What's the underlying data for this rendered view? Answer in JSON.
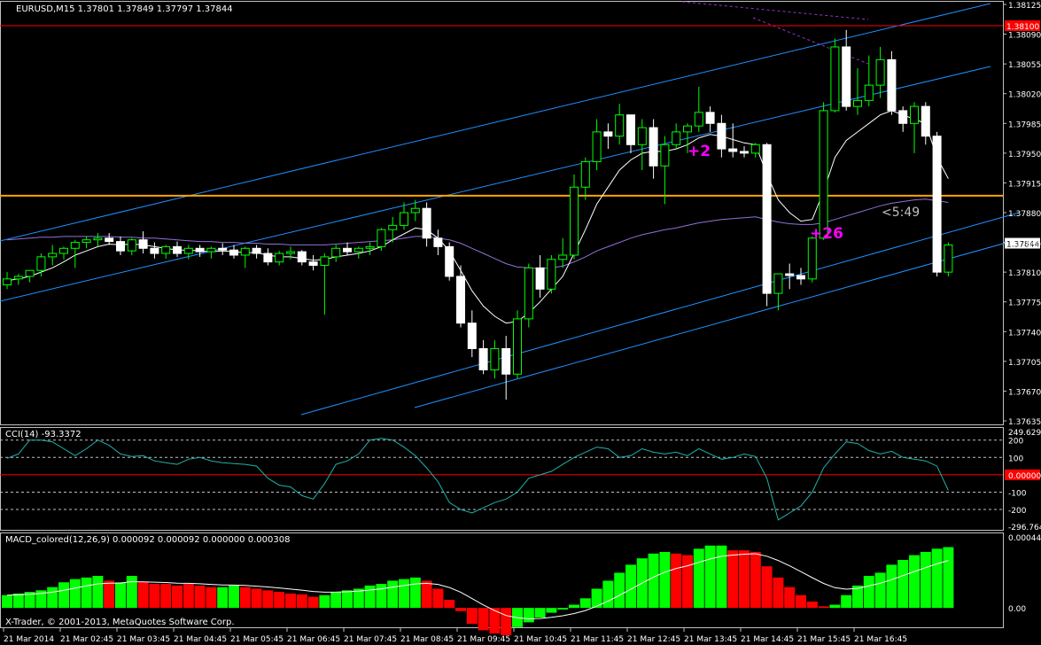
{
  "symbol_header": "EURUSD,M15  1.37801 1.37849 1.37797 1.37844",
  "copyright": "X-Trader, © 2001-2013, MetaQuotes Software Corp.",
  "colors": {
    "background": "#000000",
    "frame": "#c0c0c0",
    "bull": "#00ff00",
    "bear": "#ffffff",
    "channel": "#1e90ff",
    "ma_fast": "#ffffff",
    "ma_slow": "#9370db",
    "level_orange": "#ffa500",
    "level_red": "#ff0000",
    "cci": "#20b2aa",
    "macd_up": "#00ff00",
    "macd_down": "#ff0000",
    "annotation": "#ff00ff",
    "grid": "#c0c0c0"
  },
  "price_panel": {
    "y_ticks": [
      "1.38125",
      "1.38090",
      "1.38055",
      "1.38020",
      "1.37985",
      "1.37950",
      "1.37915",
      "1.37880",
      "1.37845",
      "1.37810",
      "1.37775",
      "1.37740",
      "1.37705",
      "1.37670",
      "1.37635"
    ],
    "ylim": [
      1.37635,
      1.38125
    ],
    "current_price": "1.37844",
    "red_level_label": "1.38100",
    "orange_level": 1.379,
    "annotations": [
      {
        "text": "+2",
        "color": "#ff00ff"
      },
      {
        "text": "+26",
        "color": "#ff00ff"
      },
      {
        "text": "<5:49",
        "color": "#c0c0c0"
      }
    ]
  },
  "cci_panel": {
    "label": "CCI(14) -93.3372",
    "y_ticks": [
      "249.6295",
      "200",
      "100",
      "0.00000",
      "-100",
      "-200",
      "-296.7648"
    ],
    "ylim": [
      -296.7648,
      249.6295
    ]
  },
  "macd_panel": {
    "label": "MACD_colored(12,26,9) 0.000092 0.000092 0.000000 0.000308",
    "y_ticks": [
      "0.000444",
      "0.00"
    ],
    "ylim": [
      -0.00011,
      0.000444
    ]
  },
  "time_axis": [
    "21 Mar 2014",
    "21 Mar 02:45",
    "21 Mar 03:45",
    "21 Mar 04:45",
    "21 Mar 05:45",
    "21 Mar 06:45",
    "21 Mar 07:45",
    "21 Mar 08:45",
    "21 Mar 09:45",
    "21 Mar 10:45",
    "21 Mar 11:45",
    "21 Mar 12:45",
    "21 Mar 13:45",
    "21 Mar 14:45",
    "21 Mar 15:45",
    "21 Mar 16:45"
  ],
  "chart_data": {
    "type": "candlestick",
    "title": "EURUSD,M15",
    "candles": [
      [
        1.37795,
        1.3781,
        1.3779,
        1.37802
      ],
      [
        1.37802,
        1.37808,
        1.37795,
        1.37805
      ],
      [
        1.37805,
        1.37812,
        1.37798,
        1.37812
      ],
      [
        1.37812,
        1.37832,
        1.37805,
        1.37828
      ],
      [
        1.37828,
        1.37842,
        1.37818,
        1.37832
      ],
      [
        1.37832,
        1.3784,
        1.37825,
        1.37838
      ],
      [
        1.37838,
        1.37848,
        1.37815,
        1.37845
      ],
      [
        1.37845,
        1.37852,
        1.37838,
        1.37848
      ],
      [
        1.37848,
        1.37856,
        1.3784,
        1.3785
      ],
      [
        1.3785,
        1.37856,
        1.37842,
        1.37846
      ],
      [
        1.37846,
        1.37852,
        1.3783,
        1.37835
      ],
      [
        1.37835,
        1.3785,
        1.3783,
        1.37848
      ],
      [
        1.37848,
        1.37858,
        1.37832,
        1.37838
      ],
      [
        1.37838,
        1.37845,
        1.37826,
        1.37832
      ],
      [
        1.37832,
        1.37842,
        1.37826,
        1.3784
      ],
      [
        1.3784,
        1.37846,
        1.37828,
        1.37832
      ],
      [
        1.37832,
        1.37842,
        1.37825,
        1.37838
      ],
      [
        1.37838,
        1.37842,
        1.37828,
        1.37834
      ],
      [
        1.37834,
        1.3784,
        1.37826,
        1.37838
      ],
      [
        1.37838,
        1.37844,
        1.3783,
        1.37836
      ],
      [
        1.37836,
        1.37842,
        1.37826,
        1.3783
      ],
      [
        1.3783,
        1.3784,
        1.37815,
        1.37838
      ],
      [
        1.37838,
        1.37842,
        1.37826,
        1.37832
      ],
      [
        1.37832,
        1.37838,
        1.37818,
        1.37822
      ],
      [
        1.37822,
        1.37835,
        1.37818,
        1.37832
      ],
      [
        1.37832,
        1.3784,
        1.37825,
        1.37834
      ],
      [
        1.37834,
        1.37836,
        1.37818,
        1.37822
      ],
      [
        1.37822,
        1.3783,
        1.37812,
        1.37818
      ],
      [
        1.37818,
        1.37832,
        1.3776,
        1.37828
      ],
      [
        1.37828,
        1.37842,
        1.37822,
        1.37838
      ],
      [
        1.37838,
        1.37845,
        1.3783,
        1.37834
      ],
      [
        1.37834,
        1.3784,
        1.37826,
        1.37838
      ],
      [
        1.37838,
        1.37845,
        1.3783,
        1.3784
      ],
      [
        1.3784,
        1.37862,
        1.37835,
        1.3786
      ],
      [
        1.3786,
        1.37875,
        1.37845,
        1.37865
      ],
      [
        1.37865,
        1.37892,
        1.3786,
        1.3788
      ],
      [
        1.3788,
        1.37895,
        1.3787,
        1.37885
      ],
      [
        1.37885,
        1.37892,
        1.3784,
        1.3785
      ],
      [
        1.3785,
        1.3786,
        1.3783,
        1.3784
      ],
      [
        1.3784,
        1.37845,
        1.378,
        1.37805
      ],
      [
        1.37805,
        1.37818,
        1.37745,
        1.3775
      ],
      [
        1.3775,
        1.37765,
        1.3771,
        1.3772
      ],
      [
        1.3772,
        1.3773,
        1.3769,
        1.37695
      ],
      [
        1.37695,
        1.3773,
        1.37685,
        1.3772
      ],
      [
        1.3772,
        1.37735,
        1.3766,
        1.3769
      ],
      [
        1.3769,
        1.37765,
        1.37685,
        1.37755
      ],
      [
        1.37755,
        1.3782,
        1.37745,
        1.37815
      ],
      [
        1.37815,
        1.3783,
        1.3778,
        1.3779
      ],
      [
        1.3779,
        1.3783,
        1.37785,
        1.37825
      ],
      [
        1.37825,
        1.3785,
        1.37815,
        1.3783
      ],
      [
        1.3783,
        1.37925,
        1.37825,
        1.3791
      ],
      [
        1.3791,
        1.37945,
        1.37895,
        1.3794
      ],
      [
        1.3794,
        1.3799,
        1.3793,
        1.37975
      ],
      [
        1.37975,
        1.37985,
        1.37955,
        1.3797
      ],
      [
        1.3797,
        1.38008,
        1.3796,
        1.37995
      ],
      [
        1.37995,
        1.37995,
        1.3795,
        1.3796
      ],
      [
        1.3796,
        1.3799,
        1.3793,
        1.3798
      ],
      [
        1.3798,
        1.3799,
        1.3792,
        1.37935
      ],
      [
        1.37935,
        1.3797,
        1.3789,
        1.3796
      ],
      [
        1.3796,
        1.37985,
        1.37955,
        1.37975
      ],
      [
        1.37975,
        1.37985,
        1.3795,
        1.37982
      ],
      [
        1.37982,
        1.38028,
        1.37975,
        1.37998
      ],
      [
        1.37998,
        1.38005,
        1.37975,
        1.37985
      ],
      [
        1.37985,
        1.37995,
        1.37945,
        1.37955
      ],
      [
        1.37955,
        1.37985,
        1.37945,
        1.37952
      ],
      [
        1.37952,
        1.37958,
        1.37945,
        1.3795
      ],
      [
        1.3795,
        1.37962,
        1.37945,
        1.3796
      ],
      [
        1.3796,
        1.37962,
        1.3777,
        1.37785
      ],
      [
        1.37785,
        1.37808,
        1.37765,
        1.37808
      ],
      [
        1.37808,
        1.3782,
        1.3779,
        1.37806
      ],
      [
        1.37806,
        1.37815,
        1.37795,
        1.37802
      ],
      [
        1.37802,
        1.37852,
        1.37798,
        1.3785
      ],
      [
        1.3785,
        1.3801,
        1.37848,
        1.38
      ],
      [
        1.38,
        1.38085,
        1.37998,
        1.38075
      ],
      [
        1.38075,
        1.38095,
        1.38,
        1.38005
      ],
      [
        1.38005,
        1.3805,
        1.37995,
        1.38012
      ],
      [
        1.38012,
        1.38065,
        1.38005,
        1.3803
      ],
      [
        1.3803,
        1.38075,
        1.38015,
        1.3806
      ],
      [
        1.3806,
        1.3807,
        1.37995,
        1.38
      ],
      [
        1.38,
        1.38005,
        1.37975,
        1.37985
      ],
      [
        1.37985,
        1.3801,
        1.3795,
        1.38005
      ],
      [
        1.38005,
        1.3801,
        1.3796,
        1.3797
      ],
      [
        1.3797,
        1.37975,
        1.37805,
        1.3781
      ],
      [
        1.3781,
        1.37845,
        1.37805,
        1.37842
      ]
    ],
    "ma_fast": [
      1.378,
      1.37802,
      1.37805,
      1.3781,
      1.37815,
      1.37822,
      1.3783,
      1.37835,
      1.3784,
      1.37843,
      1.37842,
      1.37843,
      1.37842,
      1.3784,
      1.37838,
      1.37836,
      1.37836,
      1.37835,
      1.37834,
      1.37835,
      1.37834,
      1.37833,
      1.37833,
      1.3783,
      1.37828,
      1.37828,
      1.37826,
      1.37824,
      1.37825,
      1.37828,
      1.3783,
      1.37832,
      1.37835,
      1.3784,
      1.37848,
      1.37855,
      1.37862,
      1.3786,
      1.3785,
      1.37835,
      1.37812,
      1.37788,
      1.3777,
      1.37758,
      1.3775,
      1.37752,
      1.37762,
      1.37775,
      1.3779,
      1.37805,
      1.37832,
      1.3786,
      1.3789,
      1.3791,
      1.3793,
      1.37942,
      1.3795,
      1.37952,
      1.37952,
      1.37955,
      1.3796,
      1.37968,
      1.37972,
      1.3797,
      1.37966,
      1.37962,
      1.3796,
      1.37925,
      1.37895,
      1.3788,
      1.3787,
      1.37872,
      1.37905,
      1.37945,
      1.37965,
      1.37975,
      1.37985,
      1.37995,
      1.38,
      1.37995,
      1.3799,
      1.37985,
      1.37945,
      1.3792
    ],
    "ma_slow": [
      1.37848,
      1.37849,
      1.3785,
      1.37851,
      1.37851,
      1.37852,
      1.37852,
      1.37852,
      1.37852,
      1.37852,
      1.37851,
      1.37851,
      1.3785,
      1.3785,
      1.37849,
      1.37848,
      1.37847,
      1.37846,
      1.37846,
      1.37845,
      1.37845,
      1.37844,
      1.37844,
      1.37843,
      1.37843,
      1.37842,
      1.37842,
      1.37842,
      1.37842,
      1.37843,
      1.37844,
      1.37845,
      1.37846,
      1.37847,
      1.37848,
      1.3785,
      1.37852,
      1.37852,
      1.3785,
      1.37848,
      1.37844,
      1.37838,
      1.37832,
      1.37826,
      1.3782,
      1.37816,
      1.37815,
      1.37814,
      1.37815,
      1.37817,
      1.37822,
      1.37828,
      1.37835,
      1.3784,
      1.37845,
      1.3785,
      1.37854,
      1.37857,
      1.3786,
      1.37862,
      1.37865,
      1.37868,
      1.3787,
      1.37872,
      1.37873,
      1.37874,
      1.37875,
      1.37872,
      1.37869,
      1.37867,
      1.37866,
      1.37866,
      1.37868,
      1.37872,
      1.37876,
      1.3788,
      1.37884,
      1.37888,
      1.37891,
      1.37893,
      1.37895,
      1.37896,
      1.37894,
      1.37892
    ],
    "cci": [
      95,
      120,
      200,
      200,
      190,
      150,
      110,
      150,
      200,
      170,
      120,
      105,
      110,
      80,
      70,
      60,
      90,
      100,
      80,
      70,
      65,
      60,
      50,
      -20,
      -60,
      -70,
      -120,
      -140,
      -50,
      60,
      80,
      120,
      200,
      210,
      200,
      160,
      110,
      40,
      -40,
      -160,
      -200,
      -220,
      -190,
      -160,
      -140,
      -100,
      -20,
      0,
      20,
      60,
      100,
      130,
      160,
      150,
      100,
      110,
      150,
      130,
      120,
      130,
      110,
      150,
      120,
      90,
      100,
      120,
      105,
      -20,
      -260,
      -220,
      -180,
      -100,
      40,
      120,
      190,
      180,
      140,
      120,
      135,
      100,
      90,
      80,
      50,
      -90
    ],
    "macd": [
      8e-05,
      9e-05,
      0.0001,
      0.00011,
      0.00013,
      0.00016,
      0.00018,
      0.00019,
      0.0002,
      0.00017,
      0.00016,
      0.0002,
      0.00016,
      0.00015,
      0.00015,
      0.00014,
      0.00015,
      0.00014,
      0.00013,
      0.00013,
      0.00014,
      0.00013,
      0.00012,
      0.00011,
      0.0001,
      9e-05,
      8.5e-05,
      7e-05,
      8e-05,
      0.0001,
      0.00011,
      0.00012,
      0.00014,
      0.00015,
      0.00017,
      0.00018,
      0.00019,
      0.00017,
      0.00012,
      5e-05,
      -2e-05,
      -0.0001,
      -0.00014,
      -0.00016,
      -0.00017,
      -0.00012,
      -9e-05,
      -6e-05,
      -3e-05,
      -1e-05,
      2e-05,
      6e-05,
      0.00012,
      0.00017,
      0.00022,
      0.00027,
      0.00031,
      0.00034,
      0.00035,
      0.00034,
      0.00033,
      0.00037,
      0.00039,
      0.00039,
      0.00036,
      0.00036,
      0.00035,
      0.00026,
      0.00019,
      0.00013,
      8e-05,
      4e-05,
      1e-05,
      2e-05,
      8e-05,
      0.00014,
      0.0002,
      0.00022,
      0.00027,
      0.0003,
      0.00033,
      0.00035,
      0.00037,
      0.00038,
      0.00038,
      0.00037,
      0.00034,
      0.0003,
      0.00023,
      0.00018,
      0.00013,
      9.2e-05
    ],
    "macd_colors": [
      "up",
      "up",
      "up",
      "up",
      "up",
      "up",
      "up",
      "up",
      "up",
      "down",
      "up",
      "up",
      "down",
      "down",
      "down",
      "down",
      "down",
      "down",
      "down",
      "up",
      "up",
      "down",
      "down",
      "down",
      "down",
      "down",
      "down",
      "down",
      "up",
      "up",
      "up",
      "up",
      "up",
      "up",
      "up",
      "up",
      "up",
      "down",
      "down",
      "down",
      "down",
      "down",
      "down",
      "down",
      "down",
      "up",
      "up",
      "up",
      "up",
      "up",
      "up",
      "up",
      "up",
      "up",
      "up",
      "up",
      "up",
      "up",
      "up",
      "down",
      "down",
      "up",
      "up",
      "up",
      "down",
      "down",
      "down",
      "down",
      "down",
      "down",
      "down",
      "down",
      "down",
      "up",
      "up",
      "up",
      "up",
      "up",
      "up",
      "up",
      "up",
      "up",
      "up",
      "up",
      "down",
      "up",
      "down",
      "down"
    ]
  }
}
